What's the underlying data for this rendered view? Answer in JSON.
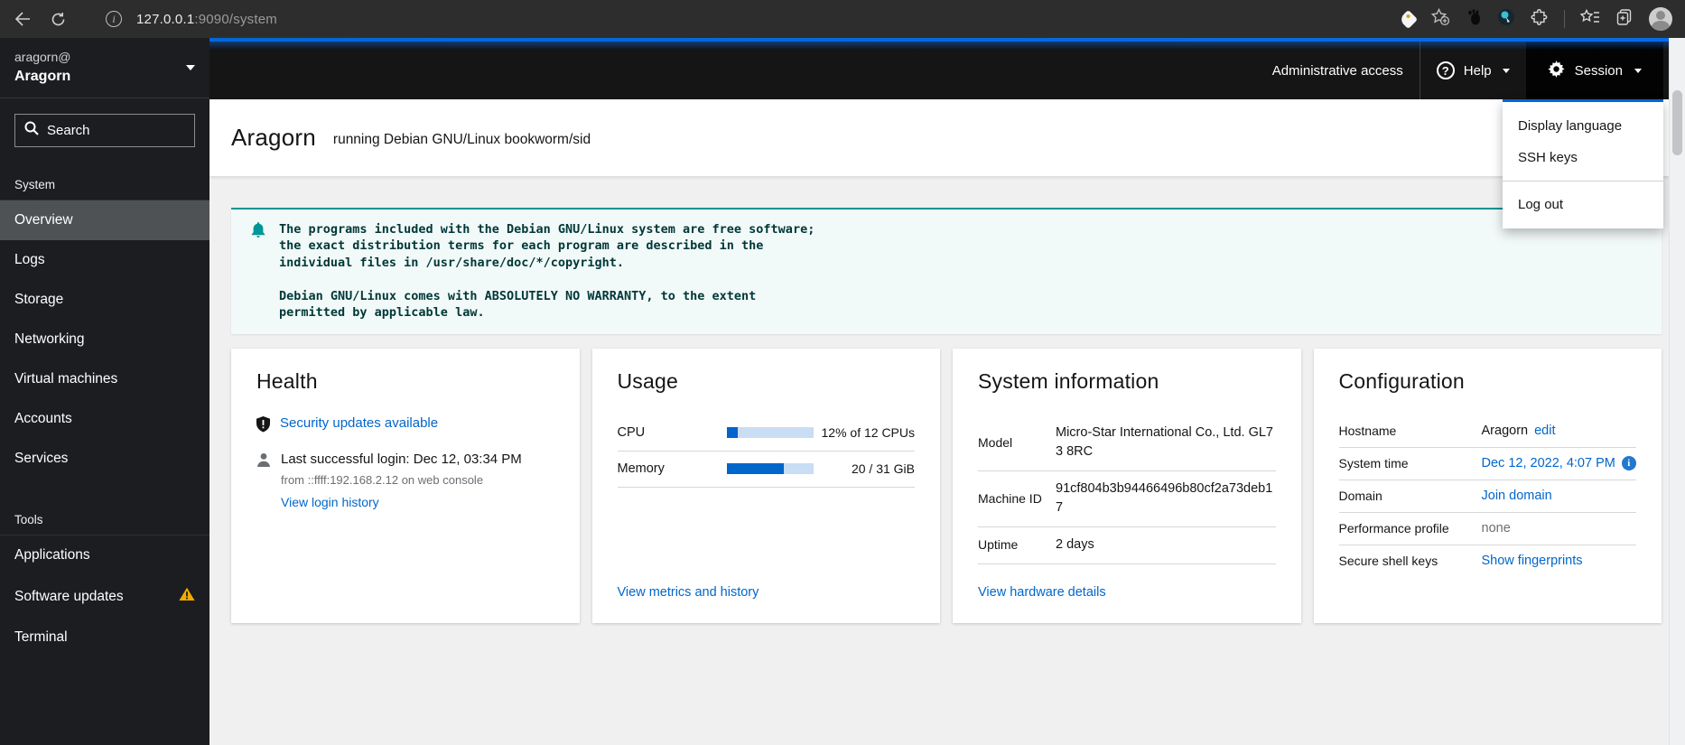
{
  "browser": {
    "url_host": "127.0.0.1",
    "url_path": ":9090/system"
  },
  "sidebar": {
    "user": "aragorn@",
    "host": "Aragorn",
    "search_placeholder": "Search",
    "sections": [
      {
        "label": "System",
        "items": [
          {
            "label": "Overview"
          },
          {
            "label": "Logs"
          },
          {
            "label": "Storage"
          },
          {
            "label": "Networking"
          },
          {
            "label": "Virtual machines"
          },
          {
            "label": "Accounts"
          },
          {
            "label": "Services"
          }
        ]
      },
      {
        "label": "Tools",
        "items": [
          {
            "label": "Applications"
          },
          {
            "label": "Software updates"
          },
          {
            "label": "Terminal"
          }
        ]
      }
    ]
  },
  "header": {
    "admin_access": "Administrative access",
    "help": "Help",
    "session": "Session"
  },
  "session_menu": {
    "items": [
      "Display language",
      "SSH keys",
      "Log out"
    ]
  },
  "page": {
    "title": "Aragorn",
    "subtitle": "running Debian GNU/Linux bookworm/sid"
  },
  "alert": {
    "text": "The programs included with the Debian GNU/Linux system are free software;\nthe exact distribution terms for each program are described in the\nindividual files in /usr/share/doc/*/copyright.\n\nDebian GNU/Linux comes with ABSOLUTELY NO WARRANTY, to the extent\npermitted by applicable law."
  },
  "cards": {
    "health": {
      "title": "Health",
      "security_link": "Security updates available",
      "login_text": "Last successful login: Dec 12, 03:34 PM",
      "login_detail": "from ::ffff:192.168.2.12 on web console",
      "login_link": "View login history"
    },
    "usage": {
      "title": "Usage",
      "rows": [
        {
          "label": "CPU",
          "percent": 12,
          "value": "12% of 12 CPUs"
        },
        {
          "label": "Memory",
          "percent": 65,
          "value": "20 / 31 GiB"
        }
      ],
      "link": "View metrics and history"
    },
    "system_info": {
      "title": "System information",
      "rows": [
        {
          "label": "Model",
          "value": "Micro-Star International Co., Ltd. GL73 8RC"
        },
        {
          "label": "Machine ID",
          "value": "91cf804b3b94466496b80cf2a73deb17"
        },
        {
          "label": "Uptime",
          "value": "2 days"
        }
      ],
      "link": "View hardware details"
    },
    "configuration": {
      "title": "Configuration",
      "rows": [
        {
          "label": "Hostname",
          "text": "Aragorn",
          "link": "edit"
        },
        {
          "label": "System time",
          "link": "Dec 12, 2022, 4:07 PM"
        },
        {
          "label": "Domain",
          "link": "Join domain"
        },
        {
          "label": "Performance profile",
          "muted": "none"
        },
        {
          "label": "Secure shell keys",
          "link": "Show fingerprints"
        }
      ]
    }
  },
  "colors": {
    "accent_blue": "#0066cc",
    "masthead_blue": "#0466d8",
    "alert_teal": "#009596",
    "warning": "#f0ab00"
  }
}
